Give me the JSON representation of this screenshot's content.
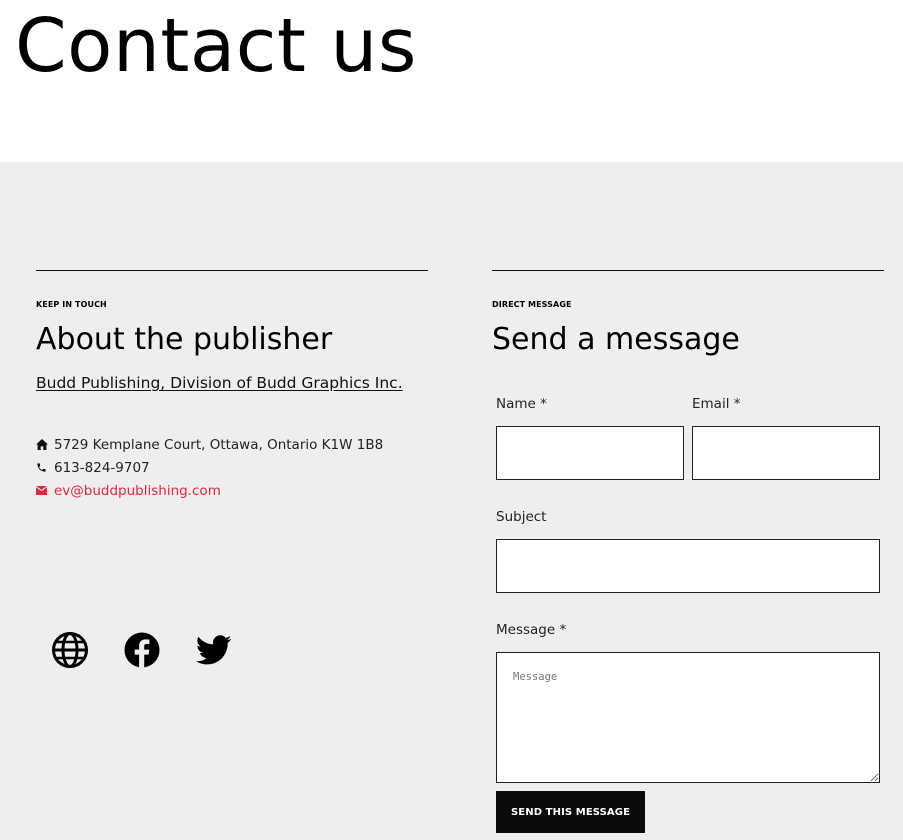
{
  "page": {
    "title": "Contact us"
  },
  "left": {
    "eyebrow": "KEEP IN TOUCH",
    "heading": "About the publisher",
    "publisher_link": "Budd Publishing, Division of Budd Graphics Inc.",
    "address": "5729 Kemplane Court, Ottawa, Ontario K1W 1B8",
    "phone": "613-824-9707",
    "email": "ev@buddpublishing.com",
    "socials": [
      {
        "icon": "globe-icon"
      },
      {
        "icon": "facebook-icon"
      },
      {
        "icon": "twitter-icon"
      }
    ]
  },
  "right": {
    "eyebrow": "DIRECT MESSAGE",
    "heading": "Send a message",
    "form": {
      "name_label": "Name *",
      "name_value": "",
      "email_label": "Email *",
      "email_value": "",
      "subject_label": "Subject",
      "subject_value": "",
      "message_label": "Message *",
      "message_placeholder": "Message",
      "submit_label": "SEND THIS MESSAGE"
    }
  },
  "colors": {
    "background": "#eeeeee",
    "accent": "#e0263f",
    "button": "#0b0b0b"
  }
}
